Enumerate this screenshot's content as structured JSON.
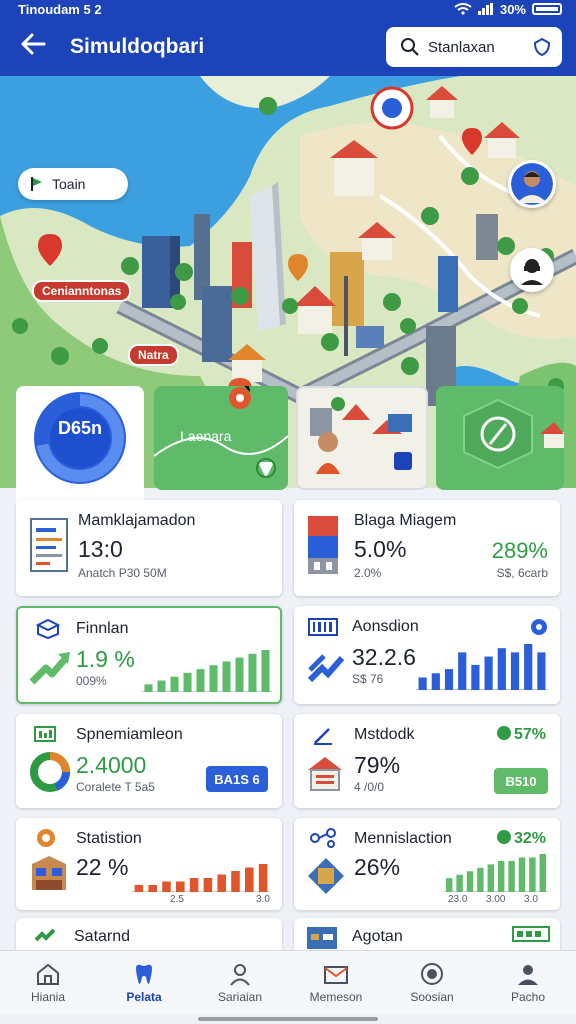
{
  "status": {
    "time": "Tinoudam 5 2",
    "battery": "30%"
  },
  "header": {
    "title": "Simuldoqbari",
    "search": "Stanlaxan"
  },
  "map": {
    "chip": "Toain",
    "labels": [
      "Cenianntonas",
      "Natra"
    ]
  },
  "tiles": {
    "ring_label": "D65n",
    "ring_percent": 0.72,
    "tile2_label": "I  aenara"
  },
  "cards": [
    {
      "title": "Mamklajamadon",
      "value": "13:0",
      "sub": "Anatch P30 50M",
      "badge": ""
    },
    {
      "title": "Blaga Miagem",
      "value": "5.0%",
      "sub": "2.0%",
      "badge": "289%",
      "badge_sub": "S$, 6carb"
    },
    {
      "title": "Finnlan",
      "value": "1.9 %",
      "sub": "009%",
      "bars": [
        2,
        3,
        4,
        5,
        6,
        7,
        8,
        9,
        10,
        11
      ]
    },
    {
      "title": "Aonsdion",
      "value": "32.2.6",
      "sub": "S$ 76",
      "bars": [
        3,
        4,
        5,
        9,
        6,
        8,
        10,
        9,
        11,
        9
      ]
    },
    {
      "title": "Spnemiamleon",
      "value": "2.4000",
      "sub": "Coralete T 5a5",
      "button": "BA1S 6"
    },
    {
      "title": "Mstdodk",
      "value": "79%",
      "sub": "4 /0/0",
      "badge": "57%",
      "button": "B510"
    },
    {
      "title": "Statistion",
      "value": "22 %",
      "sub": "",
      "bars": [
        2,
        2,
        3,
        3,
        4,
        4,
        5,
        6,
        7,
        8
      ],
      "axis": [
        "2.5",
        "3.0"
      ]
    },
    {
      "title": "Mennislaction",
      "value": "26%",
      "sub": "",
      "badge": "32%",
      "bars": [
        4,
        5,
        6,
        7,
        8,
        9,
        9,
        10,
        10,
        11
      ],
      "axis": [
        "23.0",
        "3.00",
        "3.0"
      ]
    },
    {
      "title": "Satarnd",
      "value": "",
      "sub": ""
    },
    {
      "title": "Agotan",
      "value": "",
      "sub": ""
    }
  ],
  "nav": [
    {
      "label": "Hiania",
      "icon": "home-icon"
    },
    {
      "label": "Pelata",
      "icon": "tooth-icon",
      "active": true
    },
    {
      "label": "Sariaian",
      "icon": "person-icon"
    },
    {
      "label": "Memeson",
      "icon": "mail-icon"
    },
    {
      "label": "Soosian",
      "icon": "target-icon"
    },
    {
      "label": "Pacho",
      "icon": "profile-icon"
    }
  ],
  "colors": {
    "primary": "#1c43b8",
    "green": "#5fba6a",
    "blue_bar": "#2b5fd9",
    "orange_bar": "#e0552c"
  }
}
